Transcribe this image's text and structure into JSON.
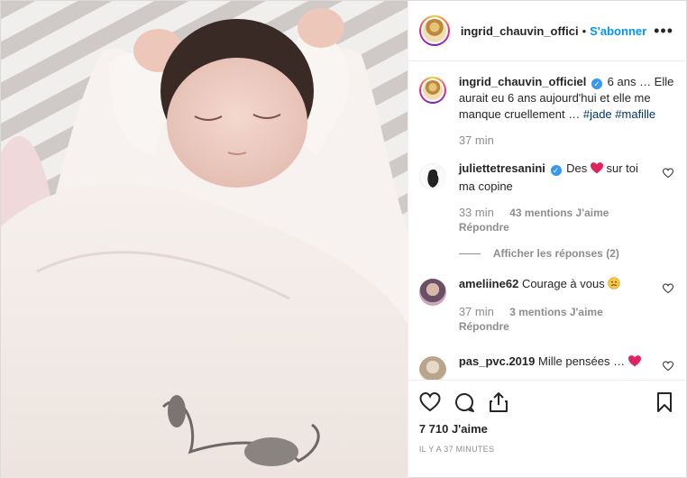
{
  "header": {
    "username": "ingrid_chauvin_offici",
    "separator": "•",
    "follow_label": "S'abonner",
    "more_label": "•••"
  },
  "caption": {
    "username": "ingrid_chauvin_officiel",
    "text": "6 ans … Elle aurait eu 6 ans aujourd'hui et elle me manque cruellement …",
    "hashtag1": "#jade",
    "hashtag2": "#mafille",
    "time": "37 min"
  },
  "comments": [
    {
      "username": "juliettetresanini",
      "text_before": "Des",
      "text_after": "sur toi ma copine",
      "time": "33 min",
      "likes": "43 mentions J'aime",
      "reply": "Répondre",
      "view_replies": "Afficher les réponses (2)"
    },
    {
      "username": "ameliine62",
      "text": "Courage à vous",
      "time": "37 min",
      "likes": "3 mentions J'aime",
      "reply": "Répondre"
    },
    {
      "username": "pas_pvc.2019",
      "text": "Mille pensées …"
    }
  ],
  "footer": {
    "likes": "7 710 J'aime",
    "ago": "IL Y A 37 MINUTES"
  },
  "icons": {
    "like": "heart-outline-icon",
    "comment": "comment-bubble-icon",
    "share": "share-icon",
    "save": "bookmark-icon"
  },
  "colors": {
    "accent": "#0095f6",
    "muted": "#8e8e8e",
    "heart_red": "#e0245e",
    "verified": "#3897f0"
  }
}
